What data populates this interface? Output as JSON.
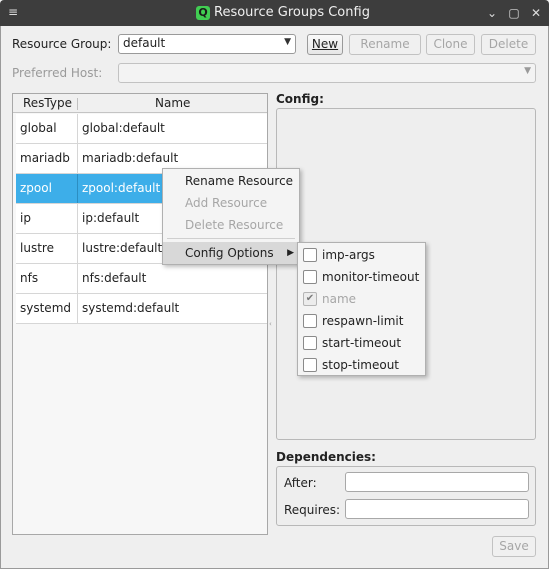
{
  "window": {
    "title": "Resource Groups Config",
    "app_icon": "Q",
    "menu_icon": "≡",
    "minimize_icon": "⌄",
    "maximize_icon": "▢",
    "close_icon": "✕"
  },
  "resource_group": {
    "label": "Resource Group:",
    "value": "default",
    "buttons": {
      "new": "New",
      "rename": "Rename",
      "clone": "Clone",
      "delete": "Delete"
    }
  },
  "preferred_host": {
    "label": "Preferred Host:",
    "value": ""
  },
  "table": {
    "headers": [
      "ResType",
      "Name"
    ],
    "rows": [
      {
        "type": "global",
        "name": "global:default"
      },
      {
        "type": "mariadb",
        "name": "mariadb:default"
      },
      {
        "type": "zpool",
        "name": "zpool:default"
      },
      {
        "type": "ip",
        "name": "ip:default"
      },
      {
        "type": "lustre",
        "name": "lustre:default"
      },
      {
        "type": "nfs",
        "name": "nfs:default"
      },
      {
        "type": "systemd",
        "name": "systemd:default"
      }
    ],
    "selected_row": 2
  },
  "context_menu": {
    "items": [
      {
        "label": "Rename Resource",
        "enabled": true
      },
      {
        "label": "Add Resource",
        "enabled": false
      },
      {
        "label": "Delete Resource",
        "enabled": false
      },
      {
        "label": "Config Options",
        "enabled": true,
        "has_submenu": true,
        "submenu_arrow": "▶"
      }
    ]
  },
  "config_options": [
    {
      "label": "imp-args",
      "checked": false,
      "enabled": true
    },
    {
      "label": "monitor-timeout",
      "checked": false,
      "enabled": true
    },
    {
      "label": "name",
      "checked": true,
      "enabled": false,
      "check_glyph": "✔"
    },
    {
      "label": "respawn-limit",
      "checked": false,
      "enabled": true
    },
    {
      "label": "start-timeout",
      "checked": false,
      "enabled": true
    },
    {
      "label": "stop-timeout",
      "checked": false,
      "enabled": true
    }
  ],
  "config": {
    "title": "Config:"
  },
  "dependencies": {
    "title": "Dependencies:",
    "after_label": "After:",
    "after_value": "",
    "requires_label": "Requires:",
    "requires_value": ""
  },
  "save_button": "Save",
  "combo_arrow": "▼",
  "colors": {
    "selection": "#3daee9",
    "titlebar": "#3d3d3d",
    "app_icon": "#41cd52"
  }
}
